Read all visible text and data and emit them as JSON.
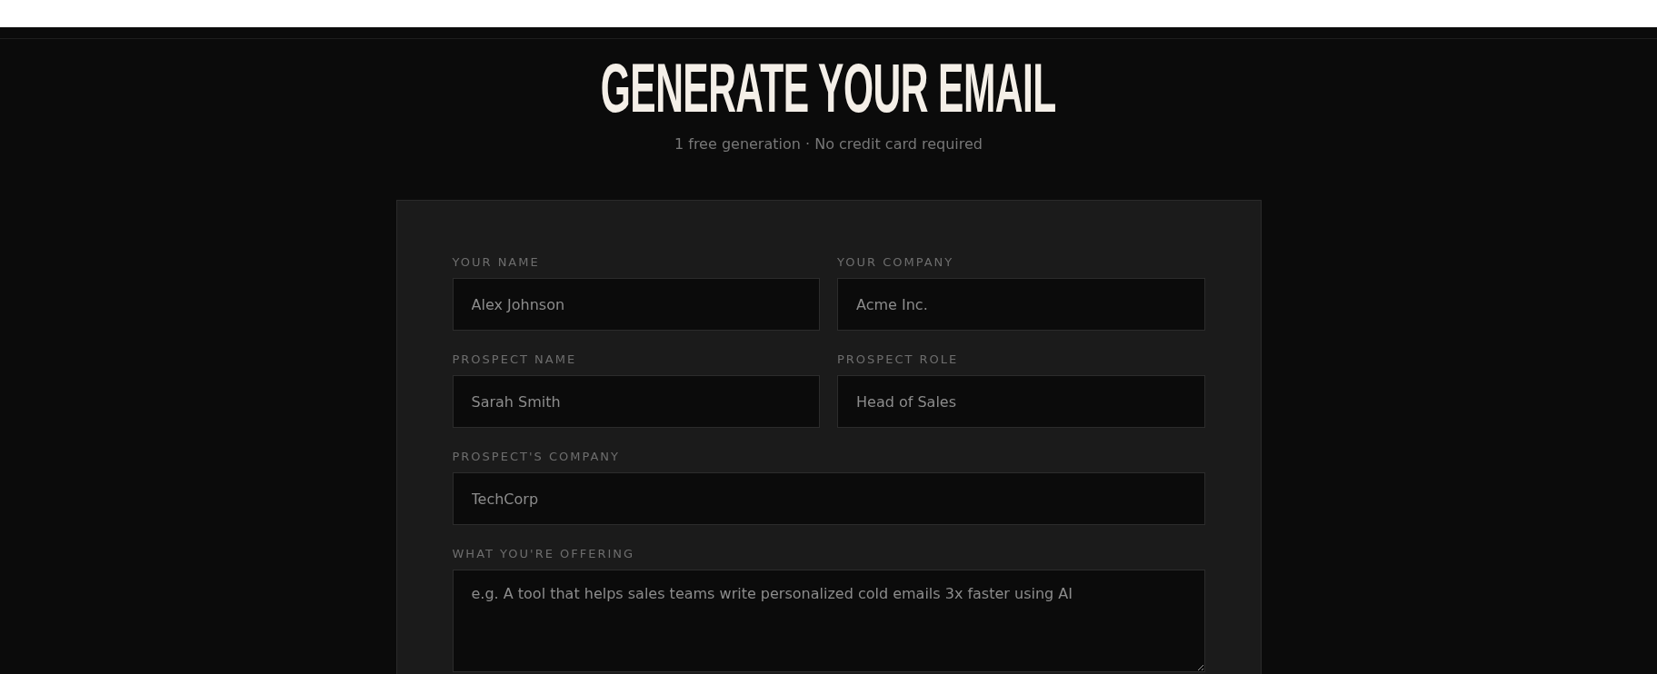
{
  "header": {
    "title": "GENERATE YOUR EMAIL",
    "subtitle": "1 free generation · No credit card required"
  },
  "form": {
    "fields": [
      {
        "label": "YOUR NAME",
        "placeholder": "Alex Johnson",
        "kind": "half"
      },
      {
        "label": "YOUR COMPANY",
        "placeholder": "Acme Inc.",
        "kind": "half"
      },
      {
        "label": "PROSPECT NAME",
        "placeholder": "Sarah Smith",
        "kind": "half"
      },
      {
        "label": "PROSPECT ROLE",
        "placeholder": "Head of Sales",
        "kind": "half"
      },
      {
        "label": "PROSPECT'S COMPANY",
        "placeholder": "TechCorp",
        "kind": "full"
      },
      {
        "label": "WHAT YOU'RE OFFERING",
        "placeholder": "e.g. A tool that helps sales teams write personalized cold emails 3x faster using AI",
        "kind": "textarea"
      }
    ]
  }
}
